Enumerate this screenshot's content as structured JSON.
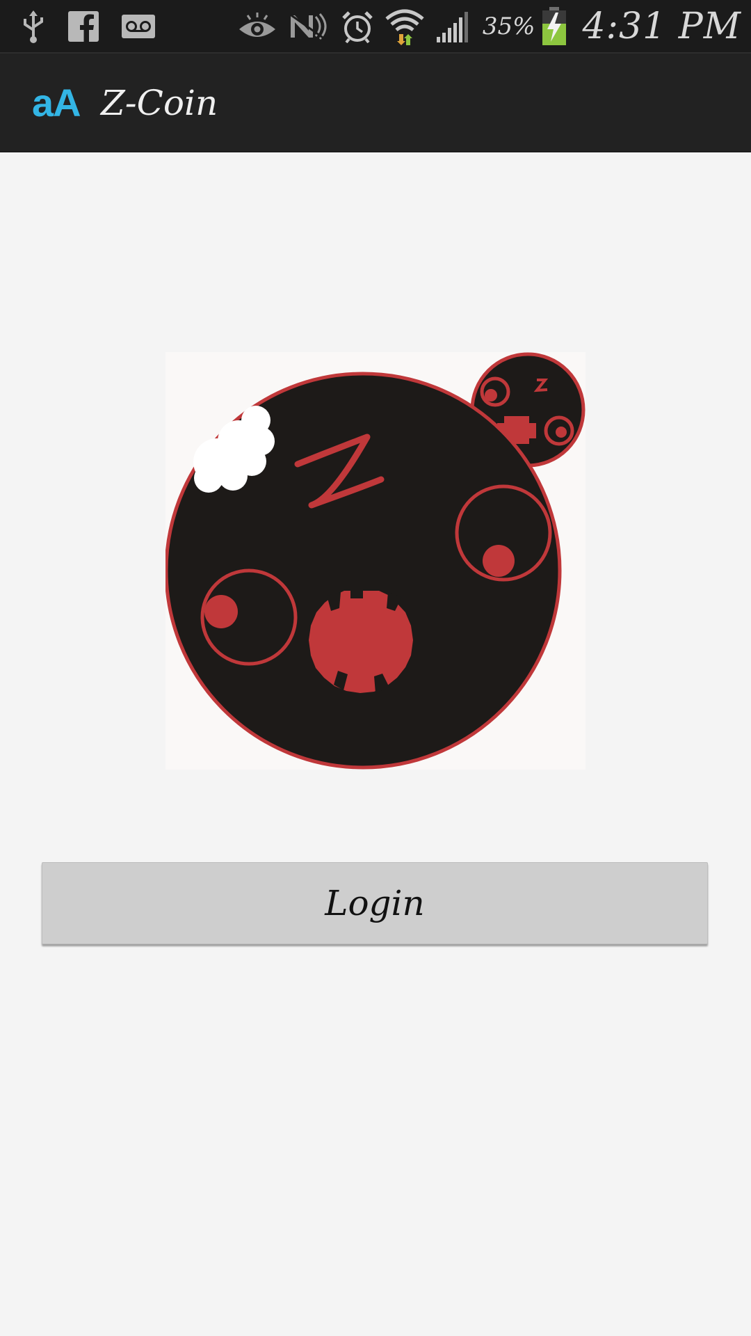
{
  "status_bar": {
    "battery_percent": "35%",
    "time": "4:31 PM",
    "icons_left": [
      "usb-icon",
      "facebook-icon",
      "voicemail-icon"
    ],
    "icons_right": [
      "eye-icon",
      "nfc-icon",
      "alarm-icon",
      "wifi-icon",
      "signal-icon",
      "battery-icon"
    ]
  },
  "action_bar": {
    "app_icon_text": "aA",
    "title": "Z-Coin",
    "background": "#222222",
    "icon_color": "#33b5e5"
  },
  "main": {
    "logo_icon": "z-coin-monster-logo",
    "login_label": "Login"
  },
  "colors": {
    "logo_red": "#c0383a",
    "logo_black": "#1d1a18",
    "page_bg": "#f4f4f4"
  }
}
